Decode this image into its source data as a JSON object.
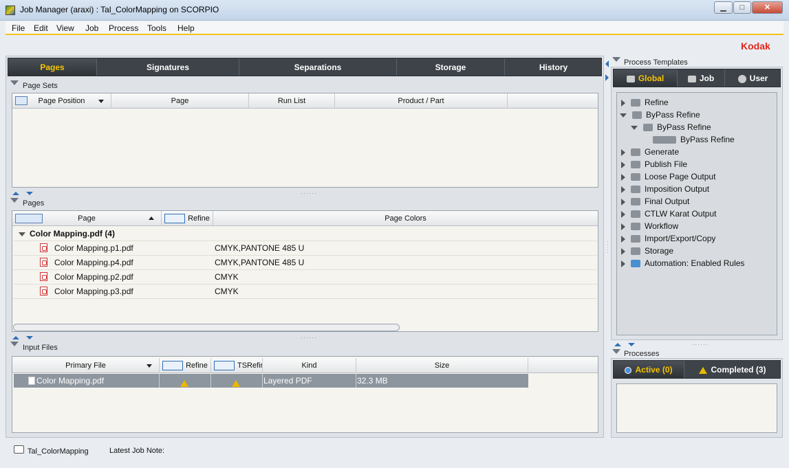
{
  "window": {
    "title": "Job Manager (araxi) : Tal_ColorMapping on SCORPIO",
    "min": "▁",
    "max": "□",
    "close": "✕"
  },
  "menu": [
    "File",
    "Edit",
    "View",
    "Job",
    "Process",
    "Tools",
    "Help"
  ],
  "brand": "Kodak",
  "main_tabs": [
    "Pages",
    "Signatures",
    "Separations",
    "Storage",
    "History"
  ],
  "page_sets": {
    "title": "Page Sets",
    "columns": [
      "Page Position",
      "Page",
      "Run List",
      "Product / Part"
    ]
  },
  "pages": {
    "title": "Pages",
    "columns": {
      "page": "Page",
      "refine": "Refine",
      "colors": "Page Colors"
    },
    "group": "Color Mapping.pdf (4)",
    "rows": [
      {
        "name": "Color Mapping.p1.pdf",
        "colors": "CMYK,PANTONE 485 U"
      },
      {
        "name": "Color Mapping.p4.pdf",
        "colors": "CMYK,PANTONE 485 U"
      },
      {
        "name": "Color Mapping.p2.pdf",
        "colors": "CMYK"
      },
      {
        "name": "Color Mapping.p3.pdf",
        "colors": "CMYK"
      }
    ]
  },
  "input_files": {
    "title": "Input Files",
    "columns": {
      "primary": "Primary File",
      "refine": "Refine",
      "tsrefine": "TSRefir",
      "kind": "Kind",
      "size": "Size"
    },
    "row": {
      "name": "Color Mapping.pdf",
      "kind": "Layered PDF",
      "size": "32.3 MB"
    }
  },
  "process_templates": {
    "title": "Process Templates",
    "tabs": [
      "Global",
      "Job",
      "User"
    ],
    "tree": [
      {
        "label": "Refine",
        "level": 0,
        "state": "collapsed"
      },
      {
        "label": "ByPass Refine",
        "level": 0,
        "state": "expanded"
      },
      {
        "label": "ByPass Refine",
        "level": 1,
        "state": "expanded"
      },
      {
        "label": "ByPass Refine",
        "level": 2,
        "state": "leaf"
      },
      {
        "label": "Generate",
        "level": 0,
        "state": "collapsed"
      },
      {
        "label": "Publish File",
        "level": 0,
        "state": "collapsed"
      },
      {
        "label": "Loose Page Output",
        "level": 0,
        "state": "collapsed"
      },
      {
        "label": "Imposition Output",
        "level": 0,
        "state": "collapsed"
      },
      {
        "label": "Final Output",
        "level": 0,
        "state": "collapsed"
      },
      {
        "label": "CTLW Karat Output",
        "level": 0,
        "state": "collapsed"
      },
      {
        "label": "Workflow",
        "level": 0,
        "state": "collapsed"
      },
      {
        "label": "Import/Export/Copy",
        "level": 0,
        "state": "collapsed"
      },
      {
        "label": "Storage",
        "level": 0,
        "state": "collapsed"
      },
      {
        "label": "Automation: Enabled Rules",
        "level": 0,
        "state": "collapsed"
      }
    ]
  },
  "processes": {
    "title": "Processes",
    "active": "Active (0)",
    "completed": "Completed (3)"
  },
  "status": {
    "job": "Tal_ColorMapping",
    "note_label": "Latest Job Note:"
  }
}
